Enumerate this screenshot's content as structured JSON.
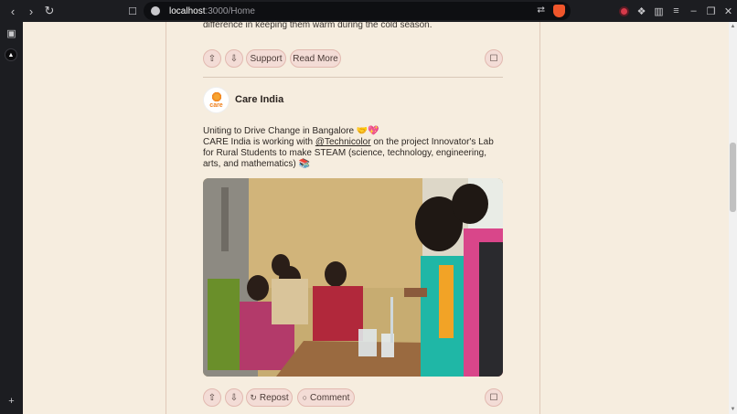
{
  "browser": {
    "url_host": "localhost",
    "url_path": ":3000/Home",
    "back_icon": "chevron-left-icon",
    "forward_icon": "chevron-right-icon",
    "reload_icon": "reload-icon"
  },
  "previous_post": {
    "tail_text": "difference in keeping them warm during the cold season.",
    "actions": {
      "support_label": "Support",
      "read_more_label": "Read More"
    }
  },
  "post": {
    "org_name": "Care India",
    "logo_text": "care",
    "line1": "Uniting to Drive Change in Bangalore 🤝💖",
    "line2_prefix": "CARE India is working with ",
    "mention": "@Technicolor",
    "line2_suffix": " on the project Innovator's Lab",
    "line3": "for Rural Students to make STEAM (science, technology, engineering,",
    "line4": "arts, and mathematics) 📚",
    "actions": {
      "repost_label": "Repost",
      "comment_label": "Comment"
    }
  },
  "colors": {
    "page_bg": "#f6eddf",
    "pill_bg": "#f3dcd6",
    "pill_border": "#e2b9b0",
    "brand_orange": "#f07f1a"
  }
}
